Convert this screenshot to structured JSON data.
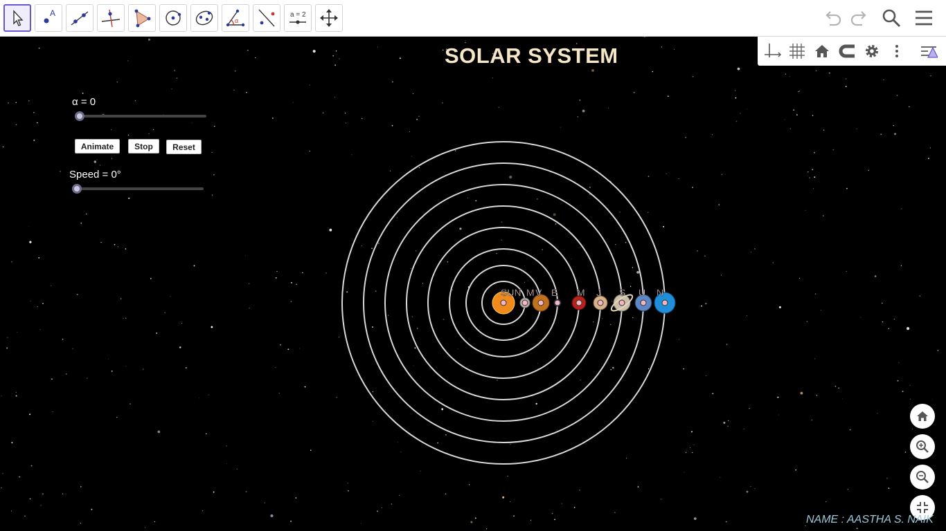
{
  "toolbar": {
    "tools": [
      {
        "name": "move-tool",
        "icon": "arrow-pointer-icon"
      },
      {
        "name": "point-tool",
        "icon": "point-icon"
      },
      {
        "name": "line-tool",
        "icon": "line-icon"
      },
      {
        "name": "perpendicular-tool",
        "icon": "perpendicular-icon"
      },
      {
        "name": "polygon-tool",
        "icon": "polygon-icon"
      },
      {
        "name": "circle-tool",
        "icon": "circle-center-icon"
      },
      {
        "name": "conic-tool",
        "icon": "ellipse-icon"
      },
      {
        "name": "angle-tool",
        "icon": "angle-icon"
      },
      {
        "name": "reflect-tool",
        "icon": "reflect-icon"
      },
      {
        "name": "slider-tool",
        "icon": "slider-icon"
      },
      {
        "name": "move-view-tool",
        "icon": "move-arrows-icon"
      }
    ],
    "slider_tool_label": "a = 2",
    "angle_tool_symbol": "α"
  },
  "title": "SOLAR SYSTEM",
  "sliders": {
    "alpha_label": "α = 0",
    "speed_label": "Speed = 0°"
  },
  "buttons": {
    "animate": "Animate",
    "stop": "Stop",
    "reset": "Reset"
  },
  "planets": {
    "sun_label": "SUN",
    "labels": [
      "M",
      "V",
      "E",
      "M",
      "J",
      "S",
      "U",
      "N"
    ]
  },
  "credit": "NAME : AASTHA S. NAIK",
  "colors": {
    "accent": "#6557d2",
    "title": "#f6e6c8",
    "orbit": "#d9d9d9",
    "point_fill": "#f4b6c2",
    "credit": "#9cc9d9"
  }
}
